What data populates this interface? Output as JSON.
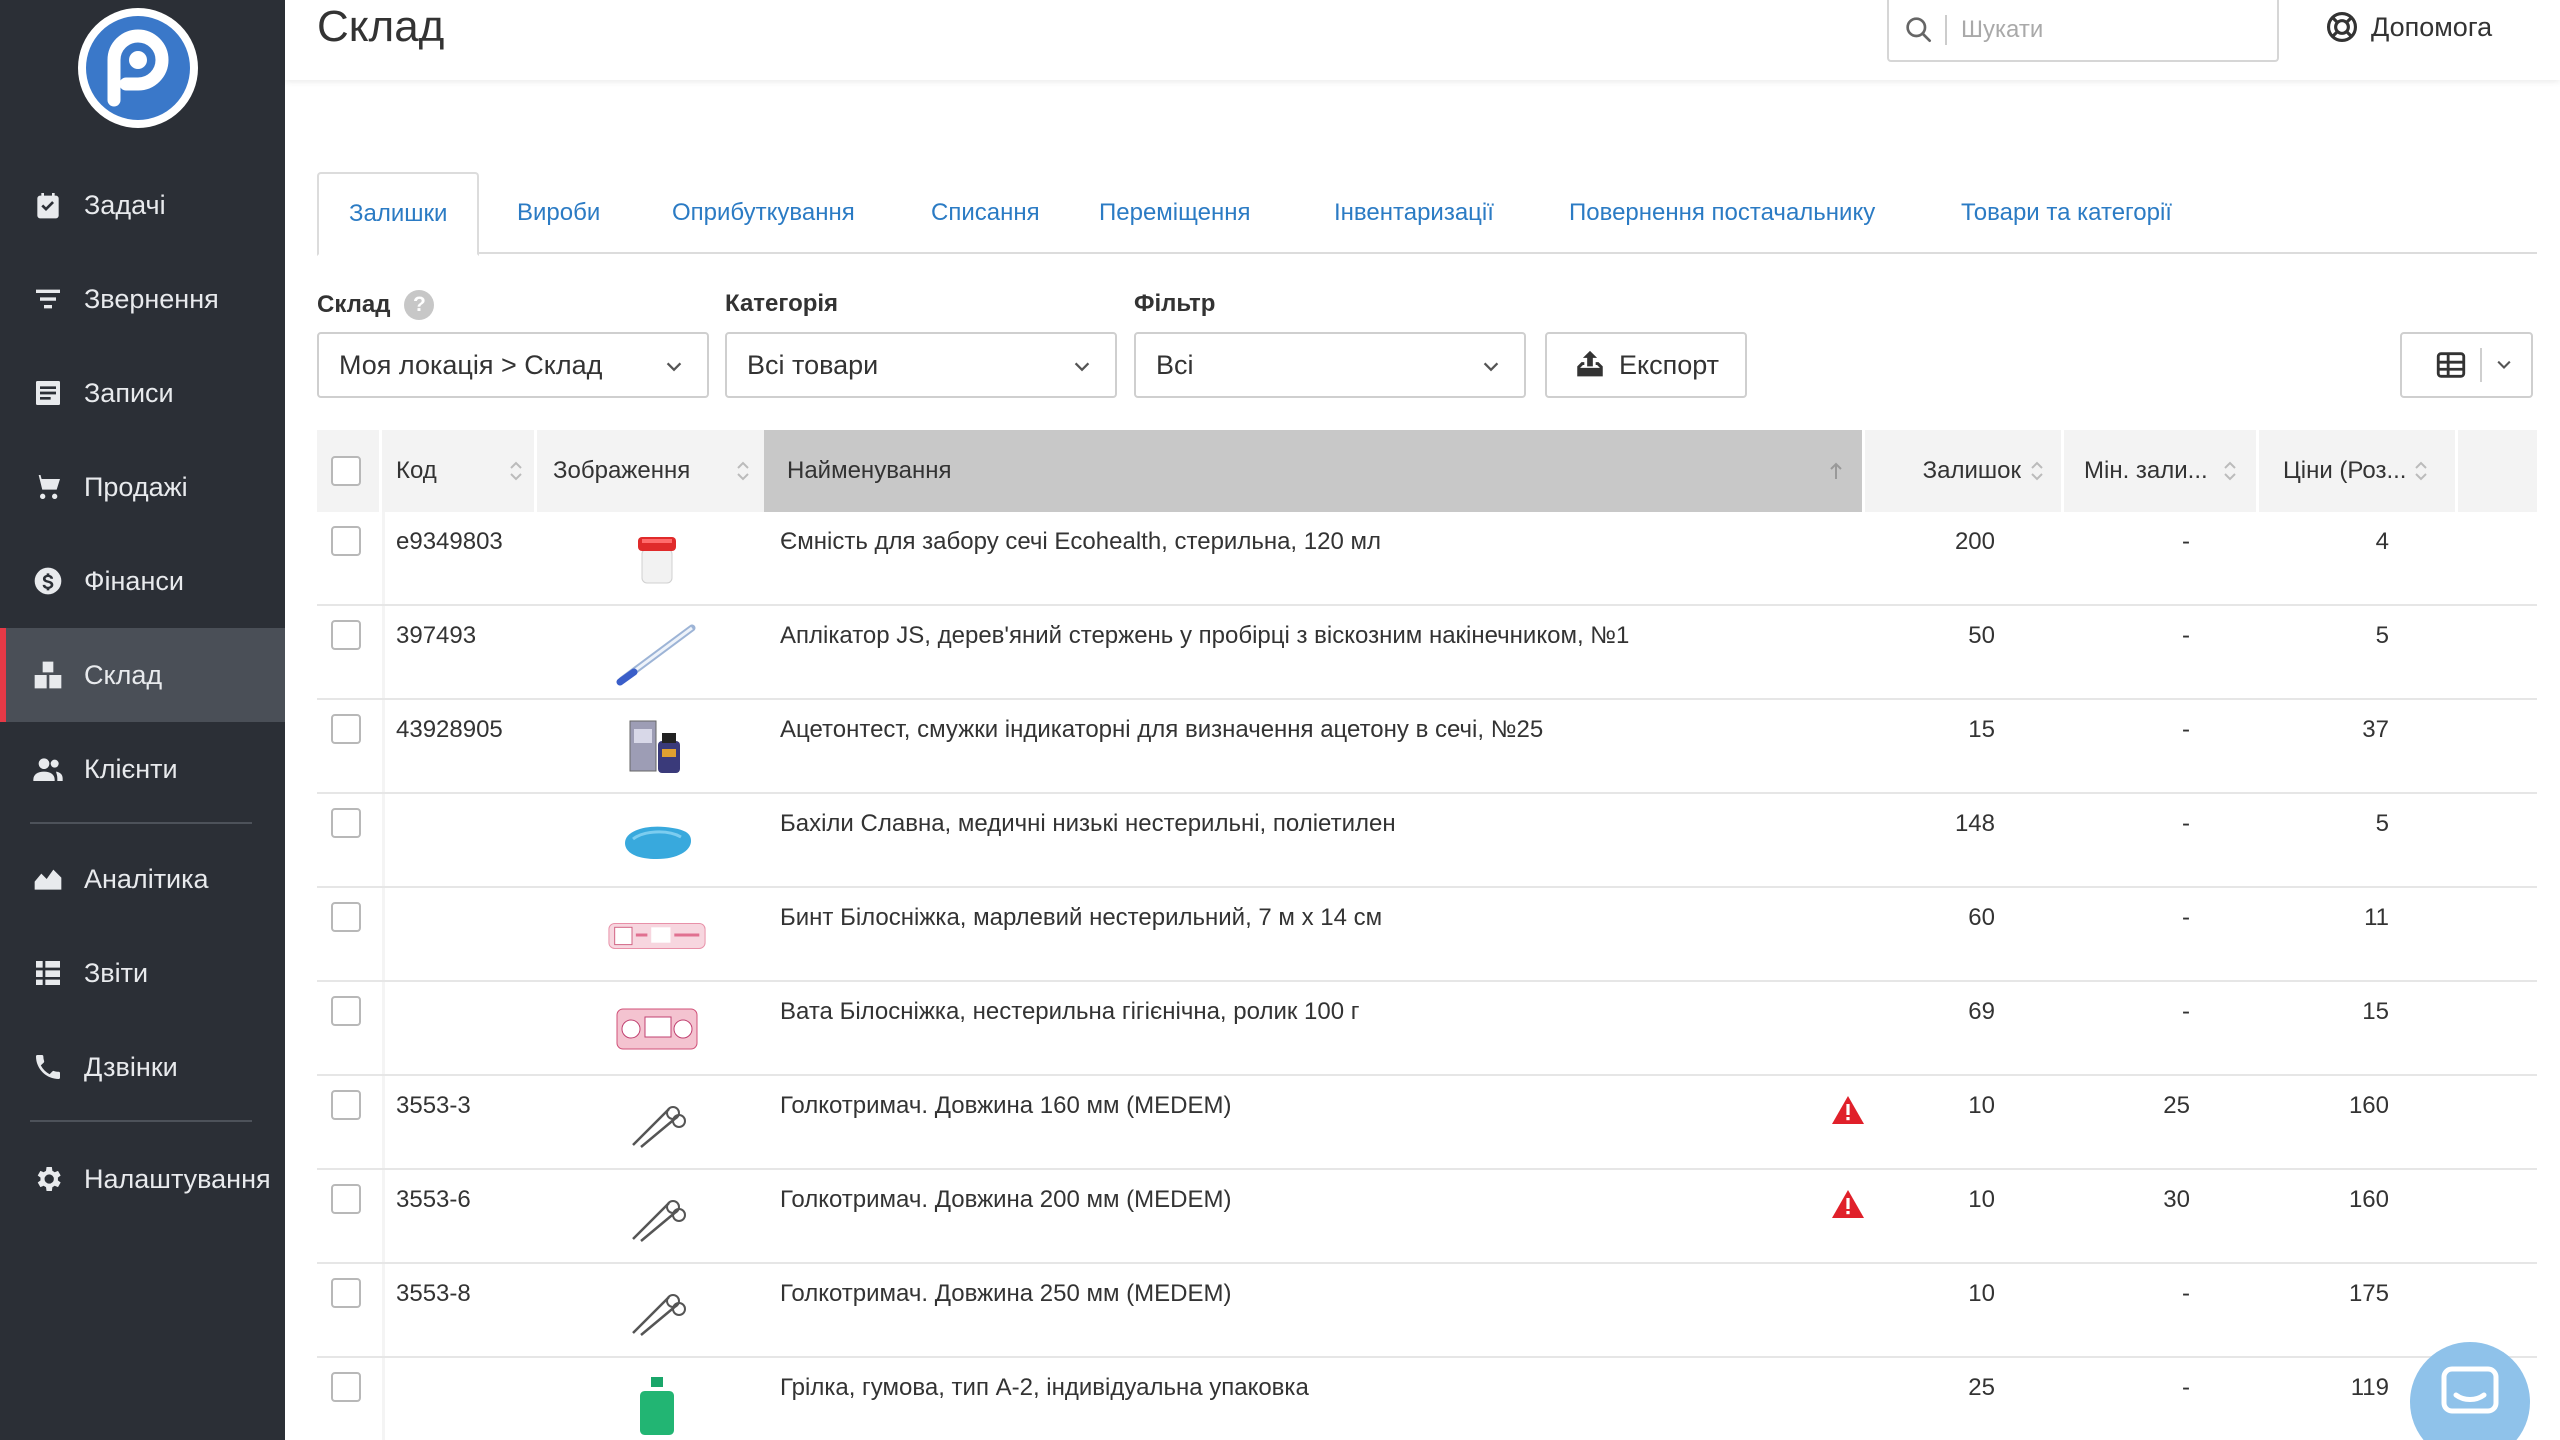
{
  "app": {
    "title": "Склад",
    "brand_color": "#2b7bc4",
    "sidebar_bg": "#2b2f36",
    "active_accent": "#e63946"
  },
  "search": {
    "placeholder": "Шукати",
    "value": ""
  },
  "help": {
    "label": "Допомога",
    "icon": "lifebuoy-icon"
  },
  "sidebar": {
    "logo": "app-logo",
    "items": [
      {
        "label": "Задачі",
        "icon": "task-icon"
      },
      {
        "label": "Звернення",
        "icon": "filter-lines-icon"
      },
      {
        "label": "Записи",
        "icon": "record-book-icon"
      },
      {
        "label": "Продажі",
        "icon": "cart-icon"
      },
      {
        "label": "Фінанси",
        "icon": "dollar-coin-icon"
      },
      {
        "label": "Склад",
        "icon": "boxes-icon",
        "active": true
      },
      {
        "label": "Клієнти",
        "icon": "users-icon"
      },
      {
        "label": "Аналітика",
        "icon": "area-chart-icon"
      },
      {
        "label": "Звіти",
        "icon": "report-table-icon"
      },
      {
        "label": "Дзвінки",
        "icon": "phone-icon"
      },
      {
        "label": "Налаштування",
        "icon": "gear-icon"
      }
    ]
  },
  "tabs": [
    {
      "label": "Залишки",
      "active": true
    },
    {
      "label": "Вироби"
    },
    {
      "label": "Оприбуткування"
    },
    {
      "label": "Списання"
    },
    {
      "label": "Переміщення"
    },
    {
      "label": "Інвентаризації"
    },
    {
      "label": "Повернення постачальнику"
    },
    {
      "label": "Товари та категорії"
    }
  ],
  "filters": {
    "warehouse": {
      "label": "Склад",
      "value": "Моя локація > Склад"
    },
    "category": {
      "label": "Категорія",
      "value": "Всі товари"
    },
    "filter": {
      "label": "Фільтр",
      "value": "Всі"
    },
    "export_label": "Експорт"
  },
  "table": {
    "headers": {
      "code": "Код",
      "image": "Зображення",
      "name": "Найменування",
      "stock": "Залишок",
      "min_stock": "Мін. зали...",
      "price": "Ціни (Роз..."
    },
    "sorted_by": "name",
    "rows": [
      {
        "code": "e9349803",
        "image": "container-image",
        "name": "Ємність для забору сечі Ecohealth, стерильна, 120 мл",
        "stock": "200",
        "min": "-",
        "price": "4",
        "warning": false
      },
      {
        "code": "397493",
        "image": "applicator-image",
        "name": "Аплікатор JS, дерев'яний стержень у пробірці з віскозним накінечником, №1",
        "stock": "50",
        "min": "-",
        "price": "5",
        "warning": false
      },
      {
        "code": "43928905",
        "image": "test-strips-image",
        "name": "Ацетонтест, смужки індикаторні для визначення ацетону в сечі, №25",
        "stock": "15",
        "min": "-",
        "price": "37",
        "warning": false
      },
      {
        "code": "",
        "image": "shoe-covers-image",
        "name": "Бахіли Славна, медичні низькі нестерильні, поліетилен",
        "stock": "148",
        "min": "-",
        "price": "5",
        "warning": false
      },
      {
        "code": "",
        "image": "bandage-image",
        "name": "Бинт Білосніжка, марлевий нестерильний, 7 м х 14 см",
        "stock": "60",
        "min": "-",
        "price": "11",
        "warning": false
      },
      {
        "code": "",
        "image": "cotton-wool-image",
        "name": "Вата Білосніжка, нестерильна гігієнічна, ролик 100 г",
        "stock": "69",
        "min": "-",
        "price": "15",
        "warning": false
      },
      {
        "code": "3553-3",
        "image": "needle-holder-image",
        "name": "Голкотримач. Довжина 160 мм (MEDEM)",
        "stock": "10",
        "min": "25",
        "price": "160",
        "warning": true
      },
      {
        "code": "3553-6",
        "image": "needle-holder-image",
        "name": "Голкотримач. Довжина 200 мм (MEDEM)",
        "stock": "10",
        "min": "30",
        "price": "160",
        "warning": true
      },
      {
        "code": "3553-8",
        "image": "needle-holder-image",
        "name": "Голкотримач. Довжина 250 мм (MEDEM)",
        "stock": "10",
        "min": "-",
        "price": "175",
        "warning": false
      },
      {
        "code": "",
        "image": "hot-water-bottle-image",
        "name": "Грілка, гумова, тип А-2, індивідуальна упаковка",
        "stock": "25",
        "min": "-",
        "price": "119",
        "warning": false
      }
    ]
  },
  "chat": {
    "icon": "chat-icon"
  }
}
